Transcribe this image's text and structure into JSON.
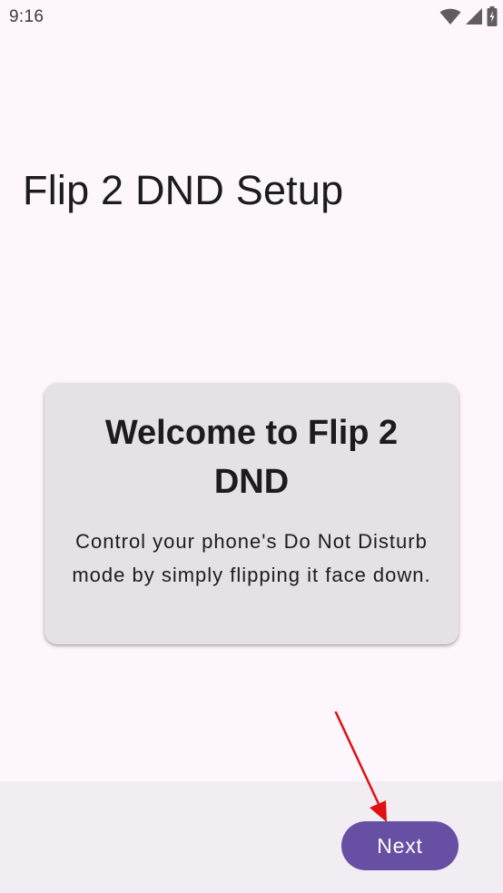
{
  "status_bar": {
    "time": "9:16",
    "icons": [
      "wifi-icon",
      "signal-icon",
      "battery-icon"
    ]
  },
  "page": {
    "title": "Flip 2 DND Setup"
  },
  "welcome_card": {
    "heading": "Welcome to Flip 2 DND",
    "body": "Control your phone's Do Not Disturb mode by simply flipping it face down."
  },
  "navigation": {
    "next_label": "Next"
  },
  "colors": {
    "background": "#fdf7fd",
    "card": "#e6e1e6",
    "bottom_bar": "#f2ecf3",
    "primary": "#6750a4",
    "annotation_arrow": "#e01010"
  }
}
